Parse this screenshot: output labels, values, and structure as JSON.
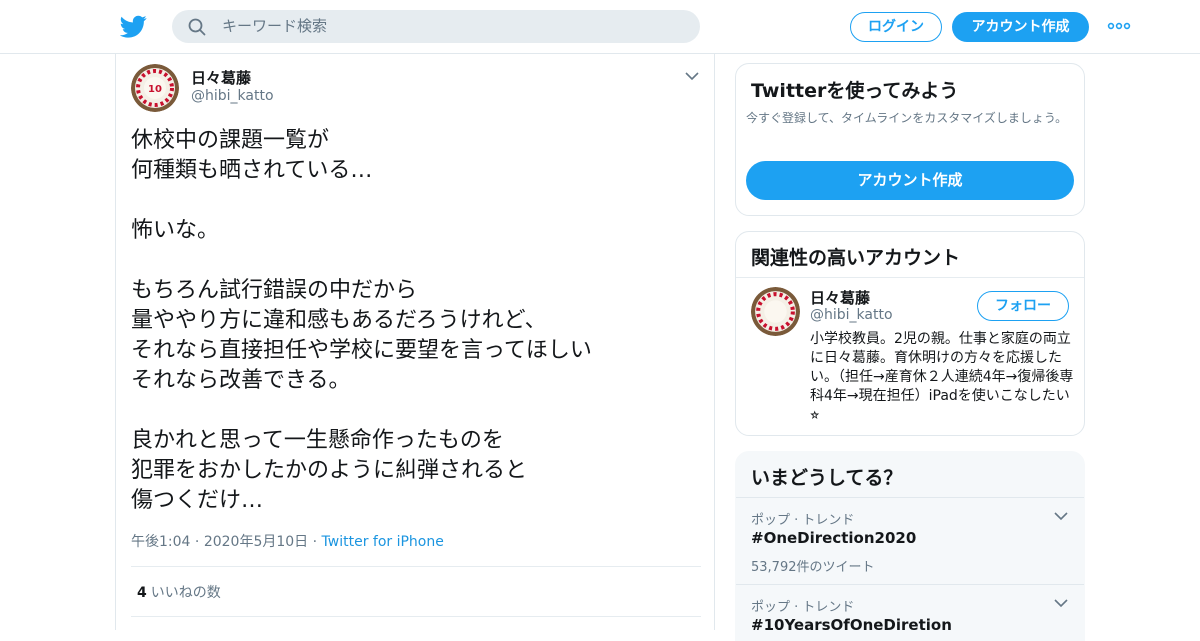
{
  "colors": {
    "accent": "#1da1f2",
    "text": "#14171a",
    "secondary": "#657786",
    "border": "#e1e8ed"
  },
  "header": {
    "search_placeholder": "キーワード検索",
    "login_label": "ログイン",
    "signup_label": "アカウント作成"
  },
  "tweet": {
    "display_name": "日々葛藤",
    "handle": "@hibi_katto",
    "avatar_text": "10",
    "text": "休校中の課題一覧が\n何種類も晒されている…\n\n怖いな。\n\nもちろん試行錯誤の中だから\n量ややり方に違和感もあるだろうけれど、\nそれなら直接担任や学校に要望を言ってほしい\nそれなら改善できる。\n\n良かれと思って一生懸命作ったものを\n犯罪をおかしたかのように糾弾されると\n傷つくだけ…",
    "time": "午後1:04",
    "date": "2020年5月10日",
    "source": "Twitter for iPhone",
    "likes_count": "4",
    "likes_label": "いいねの数"
  },
  "signup_card": {
    "title": "Twitterを使ってみよう",
    "description": "今すぐ登録して、タイムラインをカスタマイズしましょう。",
    "button_label": "アカウント作成"
  },
  "related_card": {
    "title": "関連性の高いアカウント",
    "display_name": "日々葛藤",
    "handle": "@hibi_katto",
    "follow_label": "フォロー",
    "bio": "小学校教員。2児の親。仕事と家庭の両立に日々葛藤。育休明けの方々を応援したい。（担任→産育休２人連続4年→復帰後専科4年→現在担任）iPadを使いこなしたい⭐︎"
  },
  "trends_card": {
    "title": "いまどうしてる？",
    "items": [
      {
        "context": "ポップ · トレンド",
        "name": "#OneDirection2020",
        "count": "53,792件のツイート"
      },
      {
        "context": "ポップ · トレンド",
        "name": "#10YearsOfOneDiretion",
        "count": ""
      }
    ]
  }
}
